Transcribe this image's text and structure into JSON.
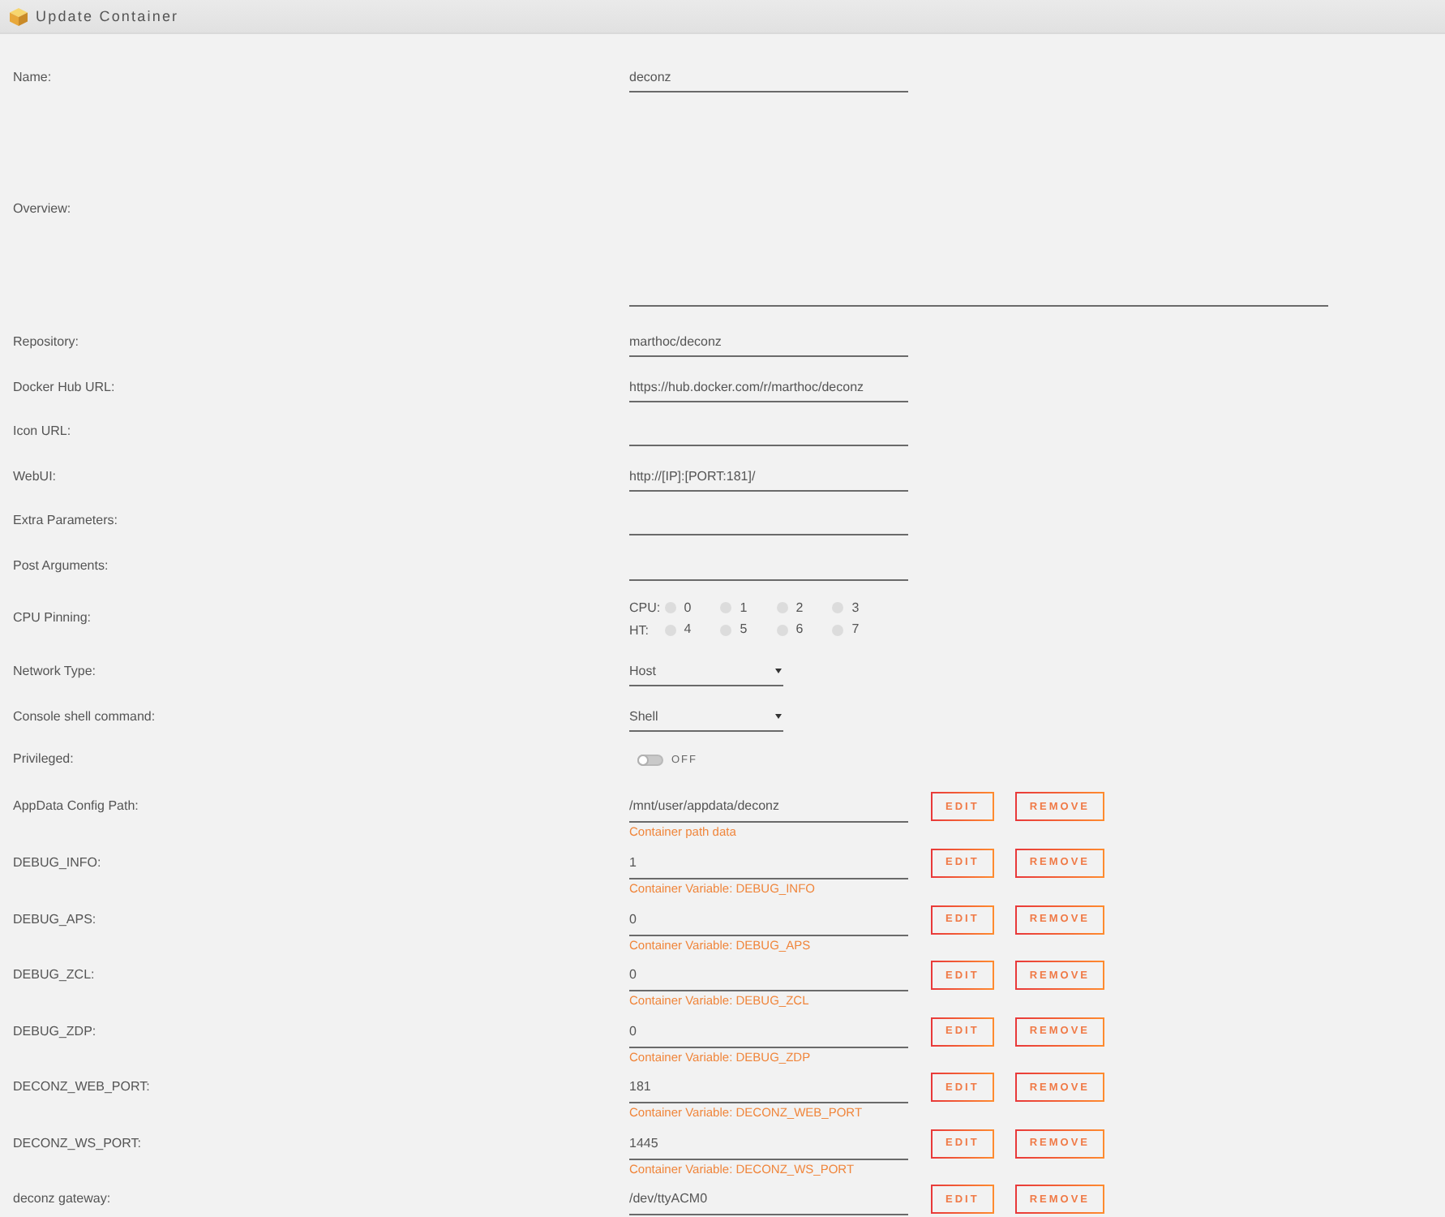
{
  "window": {
    "title": "Update Container"
  },
  "fields": [
    {
      "kind": "text",
      "label": "Name:",
      "value": "deconz"
    },
    {
      "kind": "textarea",
      "label": "Overview:"
    },
    {
      "kind": "text",
      "label": "Repository:",
      "value": "marthoc/deconz"
    },
    {
      "kind": "text",
      "label": "Docker Hub URL:",
      "value": "https://hub.docker.com/r/marthoc/deconz"
    },
    {
      "kind": "text",
      "label": "Icon URL:"
    },
    {
      "kind": "text",
      "label": "WebUI:",
      "value": "http://[IP]:[PORT:181]/"
    },
    {
      "kind": "text",
      "label": "Extra Parameters:"
    },
    {
      "kind": "text",
      "label": "Post Arguments:"
    },
    {
      "kind": "cpu_pinning",
      "label": "CPU Pinning:",
      "rows": [
        {
          "label": "CPU:",
          "cores": [
            {
              "label": "0",
              "checked": false
            },
            {
              "label": "1",
              "checked": false
            },
            {
              "label": "2",
              "checked": false
            },
            {
              "label": "3",
              "checked": false
            }
          ]
        },
        {
          "label": "HT:",
          "cores": [
            {
              "label": "4",
              "checked": false
            },
            {
              "label": "5",
              "checked": false
            },
            {
              "label": "6",
              "checked": false
            },
            {
              "label": "7",
              "checked": false
            }
          ]
        }
      ]
    },
    {
      "kind": "select",
      "label": "Network Type:",
      "value": "Host"
    },
    {
      "kind": "select",
      "label": "Console shell command:",
      "value": "Shell"
    },
    {
      "kind": "toggle",
      "label": "Privileged:",
      "on": false,
      "state_label": "OFF"
    },
    {
      "kind": "config",
      "label": "AppData Config Path:",
      "value": "/mnt/user/appdata/deconz",
      "hint": "Container path data",
      "buttons": [
        "EDIT",
        "REMOVE"
      ]
    },
    {
      "kind": "config",
      "label": "DEBUG_INFO:",
      "value": "1",
      "hint": "Container Variable: DEBUG_INFO",
      "buttons": [
        "EDIT",
        "REMOVE"
      ]
    },
    {
      "kind": "config",
      "label": "DEBUG_APS:",
      "value": "0",
      "hint": "Container Variable: DEBUG_APS",
      "buttons": [
        "EDIT",
        "REMOVE"
      ]
    },
    {
      "kind": "config",
      "label": "DEBUG_ZCL:",
      "value": "0",
      "hint": "Container Variable: DEBUG_ZCL",
      "buttons": [
        "EDIT",
        "REMOVE"
      ]
    },
    {
      "kind": "config",
      "label": "DEBUG_ZDP:",
      "value": "0",
      "hint": "Container Variable: DEBUG_ZDP",
      "buttons": [
        "EDIT",
        "REMOVE"
      ]
    },
    {
      "kind": "config",
      "label": "DECONZ_WEB_PORT:",
      "value": "181",
      "hint": "Container Variable: DECONZ_WEB_PORT",
      "buttons": [
        "EDIT",
        "REMOVE"
      ]
    },
    {
      "kind": "config",
      "label": "DECONZ_WS_PORT:",
      "value": "1445",
      "hint": "Container Variable: DECONZ_WS_PORT",
      "buttons": [
        "EDIT",
        "REMOVE"
      ]
    },
    {
      "kind": "config",
      "label": "deconz gateway:",
      "value": "/dev/ttyACM0",
      "buttons": [
        "EDIT",
        "REMOVE"
      ]
    }
  ]
}
